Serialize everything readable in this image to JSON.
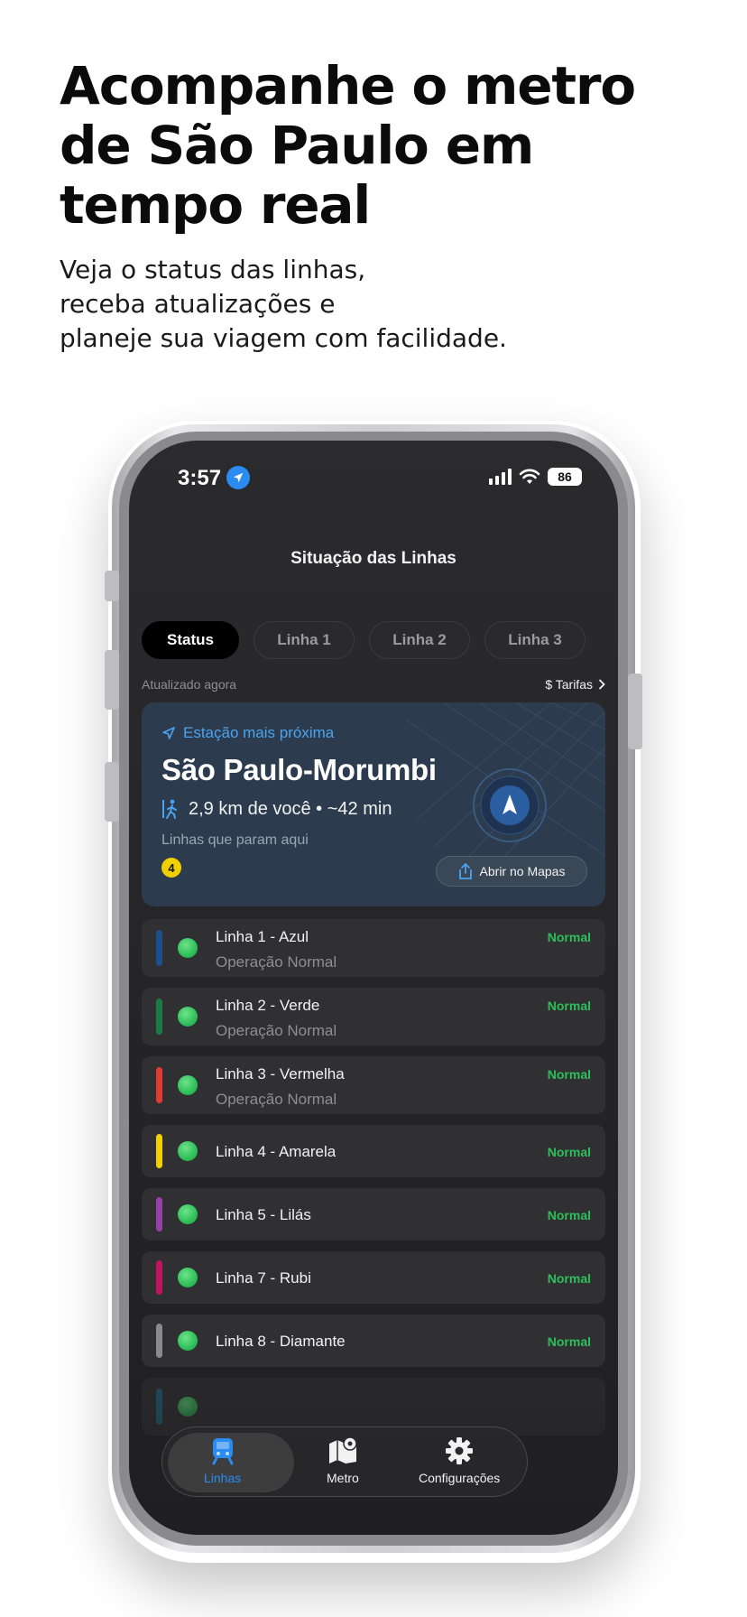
{
  "promo": {
    "title_lines": [
      "Acompanhe o metro",
      "de São Paulo em",
      "tempo real"
    ],
    "subtitle_lines": [
      "Veja o status das linhas,",
      "receba atualizações  e",
      "planeje sua viagem com facilidade."
    ]
  },
  "status_bar": {
    "time": "3:57",
    "battery": "86",
    "location_icon": "location-arrow-icon",
    "signal_icon": "cellular-signal-icon",
    "wifi_icon": "wifi-icon"
  },
  "nav": {
    "title": "Situação das Linhas"
  },
  "tabs": [
    {
      "label": "Status",
      "active": true
    },
    {
      "label": "Linha 1",
      "active": false
    },
    {
      "label": "Linha 2",
      "active": false
    },
    {
      "label": "Linha 3",
      "active": false
    }
  ],
  "updated_label": "Atualizado agora",
  "fares_label": "$ Tarifas",
  "nearest": {
    "label": "Estação mais próxima",
    "station": "São Paulo-Morumbi",
    "distance": "2,9 km de você • ~42 min",
    "lines_label": "Linhas que param aqui",
    "line_badges": [
      "4"
    ],
    "open_maps": "Abrir no Mapas",
    "accent_color": "#4aa3f0"
  },
  "lines": [
    {
      "name": "Linha 1 - Azul",
      "sub": "Operação Normal",
      "status": "Normal",
      "color": "#1f4e8c"
    },
    {
      "name": "Linha 2 - Verde",
      "sub": "Operação Normal",
      "status": "Normal",
      "color": "#1e7a45"
    },
    {
      "name": "Linha 3 - Vermelha",
      "sub": "Operação Normal",
      "status": "Normal",
      "color": "#e03a32"
    },
    {
      "name": "Linha 4 - Amarela",
      "sub": "",
      "status": "Normal",
      "color": "#f2d000"
    },
    {
      "name": "Linha 5 - Lilás",
      "sub": "",
      "status": "Normal",
      "color": "#9a3fa6"
    },
    {
      "name": "Linha 7 - Rubi",
      "sub": "",
      "status": "Normal",
      "color": "#c3125f"
    },
    {
      "name": "Linha 8 - Diamante",
      "sub": "",
      "status": "Normal",
      "color": "#8a8a8e"
    }
  ],
  "tabbar": {
    "items": [
      {
        "label": "Linhas",
        "icon": "train-icon",
        "active": true
      },
      {
        "label": "Metro",
        "icon": "map-pin-icon",
        "active": false
      },
      {
        "label": "Configurações",
        "icon": "gear-icon",
        "active": false
      }
    ],
    "active_color": "#2a8cf0"
  },
  "status_color": "#2fbf5a"
}
